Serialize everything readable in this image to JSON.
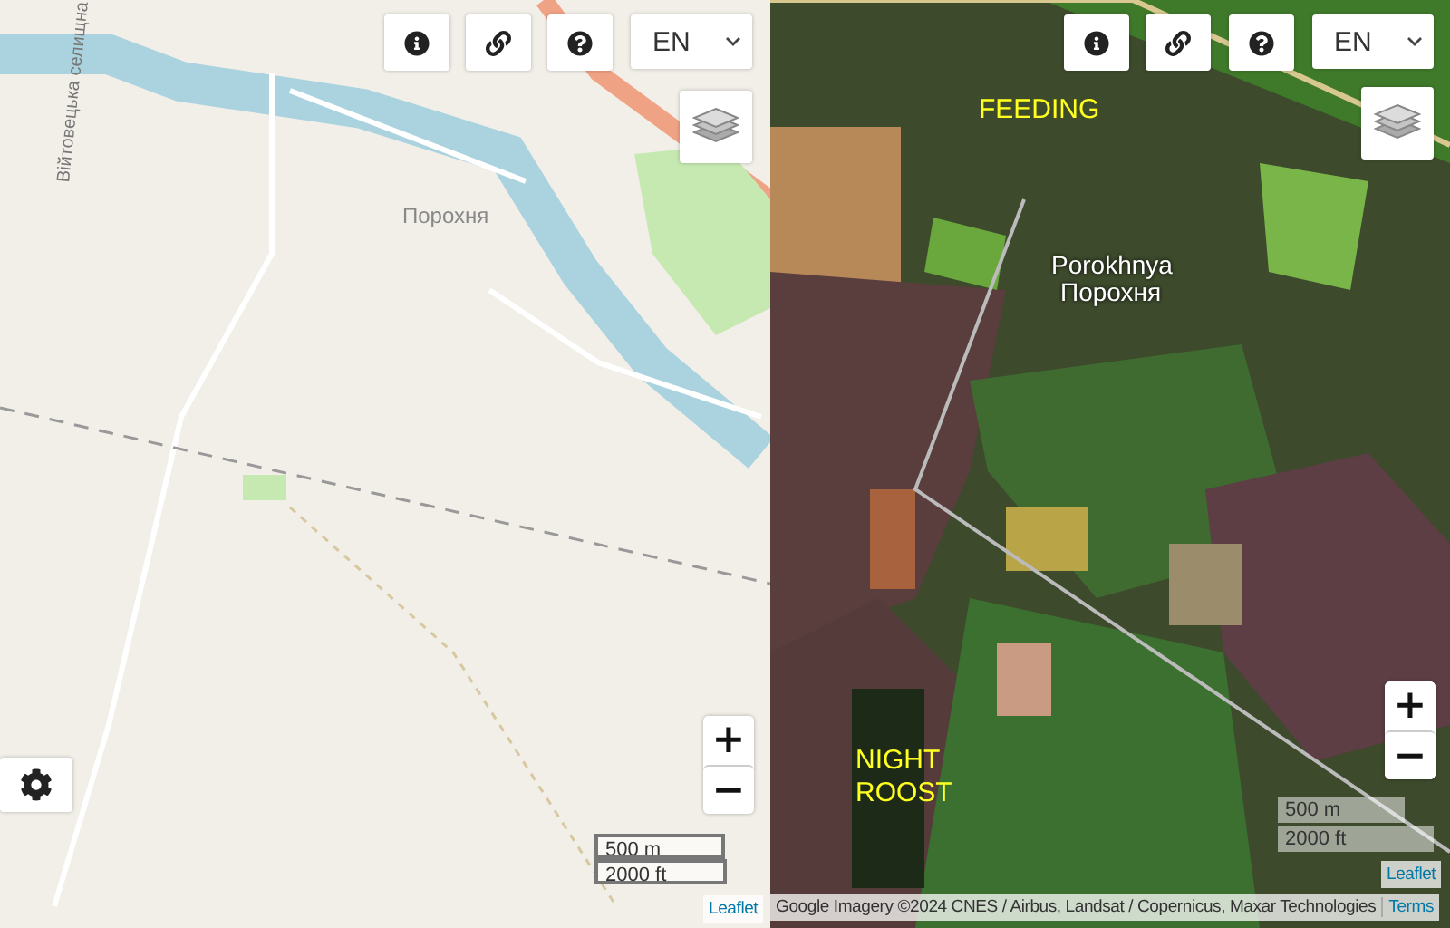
{
  "panes": [
    {
      "kind": "street",
      "labels": [
        {
          "kind": "road",
          "text": "Війтовецька селищна"
        },
        {
          "kind": "place",
          "text": "Порохня"
        }
      ],
      "buttons": [
        {
          "kind": "info"
        },
        {
          "kind": "link"
        },
        {
          "kind": "help"
        }
      ],
      "language": "EN",
      "zoom": [
        "+",
        "−"
      ],
      "scale": [
        "500 m",
        "2000 ft"
      ],
      "settings": true,
      "attribution": [
        {
          "kind": "link",
          "text": "Leaflet"
        }
      ]
    },
    {
      "kind": "satellite",
      "labels": [
        {
          "kind": "note",
          "text": "FEEDING"
        },
        {
          "kind": "town",
          "text": "Porokhnya"
        },
        {
          "kind": "town",
          "text": "Порохня"
        },
        {
          "kind": "note",
          "text": "NIGHT ROOST"
        }
      ],
      "buttons": [
        {
          "kind": "info"
        },
        {
          "kind": "link"
        },
        {
          "kind": "help"
        }
      ],
      "language": "EN",
      "zoom": [
        "+",
        "−"
      ],
      "scale": [
        "500 m",
        "2000 ft"
      ],
      "leaflet": "Leaflet",
      "attribution": [
        {
          "kind": "text",
          "text": "Google Imagery ©2024 CNES / Airbus, Landsat / Copernicus, Maxar Technologies"
        },
        {
          "kind": "link",
          "text": "Terms"
        }
      ]
    }
  ]
}
